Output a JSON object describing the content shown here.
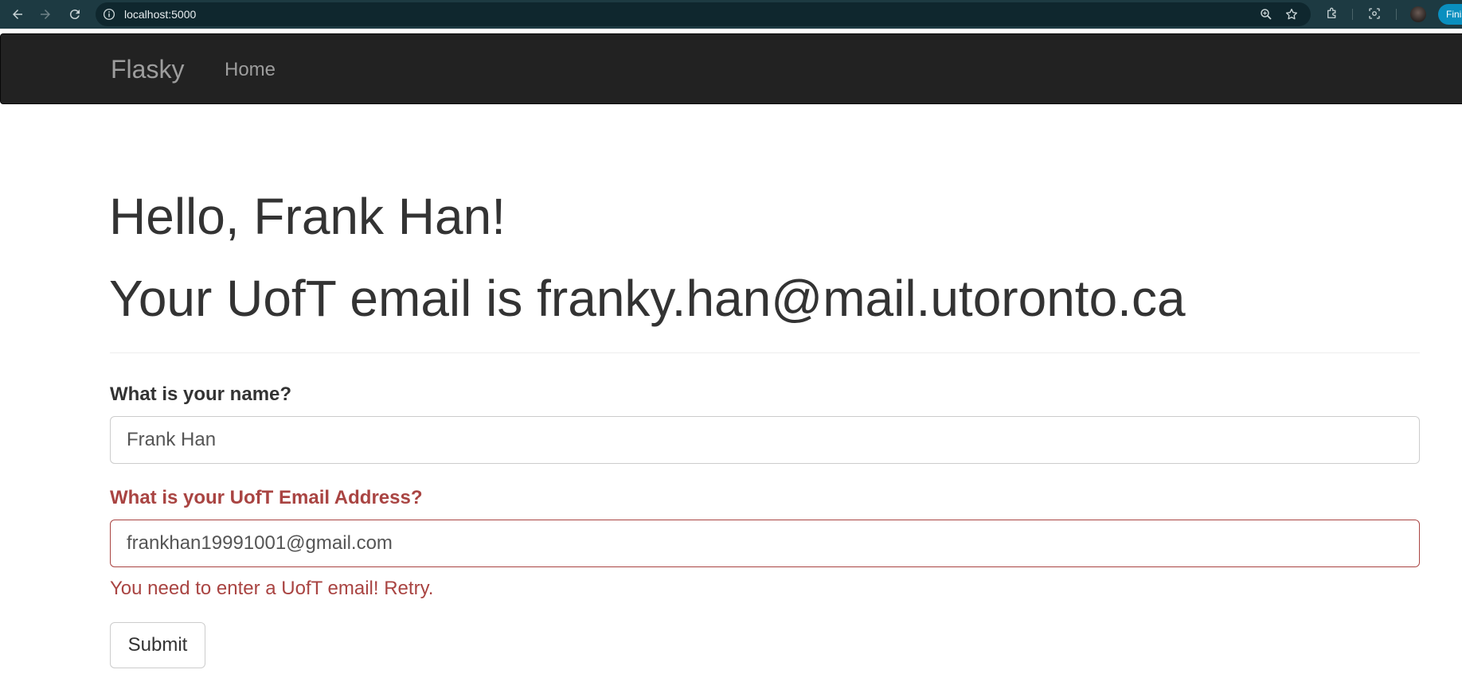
{
  "browser": {
    "url": "localhost:5000",
    "profile_badge": "Finish",
    "icons": {
      "back": "arrow-left-icon",
      "forward": "arrow-right-icon",
      "reload": "reload-icon",
      "site_info": "info-icon",
      "zoom": "zoom-icon",
      "bookmark": "star-icon",
      "extensions": "puzzle-icon",
      "lens": "lens-icon"
    }
  },
  "navbar": {
    "brand": "Flasky",
    "links": [
      {
        "label": "Home"
      }
    ],
    "background": "#222222",
    "link_color": "#9d9d9d"
  },
  "page": {
    "greeting": "Hello, Frank Han!",
    "email_message": "Your UofT email is franky.han@mail.utoronto.ca"
  },
  "form": {
    "name_label": "What is your name?",
    "name_value": "Frank Han",
    "email_label": "What is your UofT Email Address?",
    "email_value": "frankhan19991001@gmail.com",
    "email_error": "You need to enter a UofT email! Retry.",
    "submit_label": "Submit",
    "error_color": "#a94442"
  }
}
